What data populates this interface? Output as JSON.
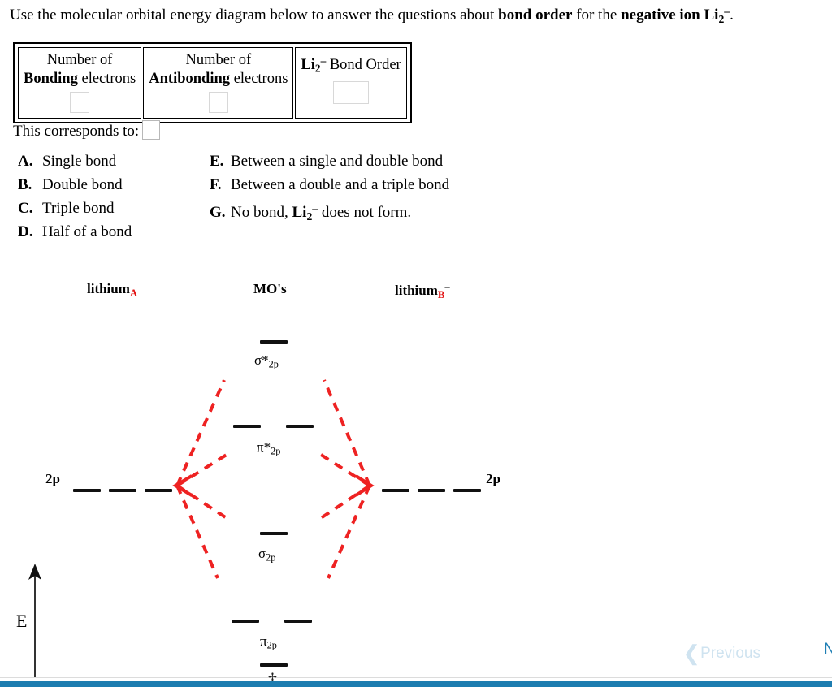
{
  "prompt": {
    "part1": "Use the molecular orbital energy diagram below to answer the questions about ",
    "bold1": "bond order",
    "part2": " for the ",
    "bold2": "negative ion Li",
    "bold2_sub": "2",
    "bold2_sup": "–",
    "part3": "."
  },
  "table": {
    "col1_line1": "Number of",
    "col1_bold": "Bonding",
    "col1_rest": " electrons",
    "col1_value": "",
    "col2_line1": "Number of",
    "col2_bold": "Antibonding",
    "col2_rest": " electrons",
    "col2_value": "",
    "col3_bold": "Li",
    "col3_sub": "2",
    "col3_sup": "–",
    "col3_rest": " Bond Order",
    "col3_value": ""
  },
  "corresponds": {
    "label": "This corresponds to:",
    "value": ""
  },
  "choices_left": [
    {
      "letter": "A.",
      "text": "Single bond"
    },
    {
      "letter": "B.",
      "text": "Double bond"
    },
    {
      "letter": "C.",
      "text": "Triple bond"
    },
    {
      "letter": "D.",
      "text": "Half of a bond"
    }
  ],
  "choices_right": [
    {
      "letter": "E.",
      "text": "Between a single and double bond"
    },
    {
      "letter": "F.",
      "text": "Between a double and a triple bond"
    },
    {
      "letter": "G.",
      "text": "No bond, Li₂⁻ does not form."
    }
  ],
  "choices_right_g": {
    "letter": "G.",
    "pre": "No bond, ",
    "bold": "Li",
    "sub": "2",
    "sup": "–",
    "post": " does not form."
  },
  "diagram": {
    "title_left_main": "lithium",
    "title_left_sub": "A",
    "title_center": "MO's",
    "title_right_main": "lithium",
    "title_right_sub": "B",
    "title_right_sup": "–",
    "atomic_left_label": "2p",
    "atomic_right_label": "2p",
    "energy_axis_label": "E",
    "levels": [
      {
        "name": "sigma-star-2p",
        "label_main": "σ*",
        "label_sub": "2p"
      },
      {
        "name": "pi-star-2p",
        "label_main": "π*",
        "label_sub": "2p"
      },
      {
        "name": "sigma-2p",
        "label_main": "σ",
        "label_sub": "2p"
      },
      {
        "name": "pi-2p",
        "label_main": "π",
        "label_sub": "2p"
      },
      {
        "name": "lower-level-cut",
        "label_main": "",
        "label_sub": ""
      }
    ]
  },
  "nav": {
    "previous": "Previous",
    "next": "N"
  },
  "colors": {
    "correlation_line": "#ee2222",
    "red_subscript": "#e21414",
    "bottom_bar": "#1d7db0",
    "prev_disabled": "#cfe3f0",
    "next_active": "#1f7fb5"
  }
}
